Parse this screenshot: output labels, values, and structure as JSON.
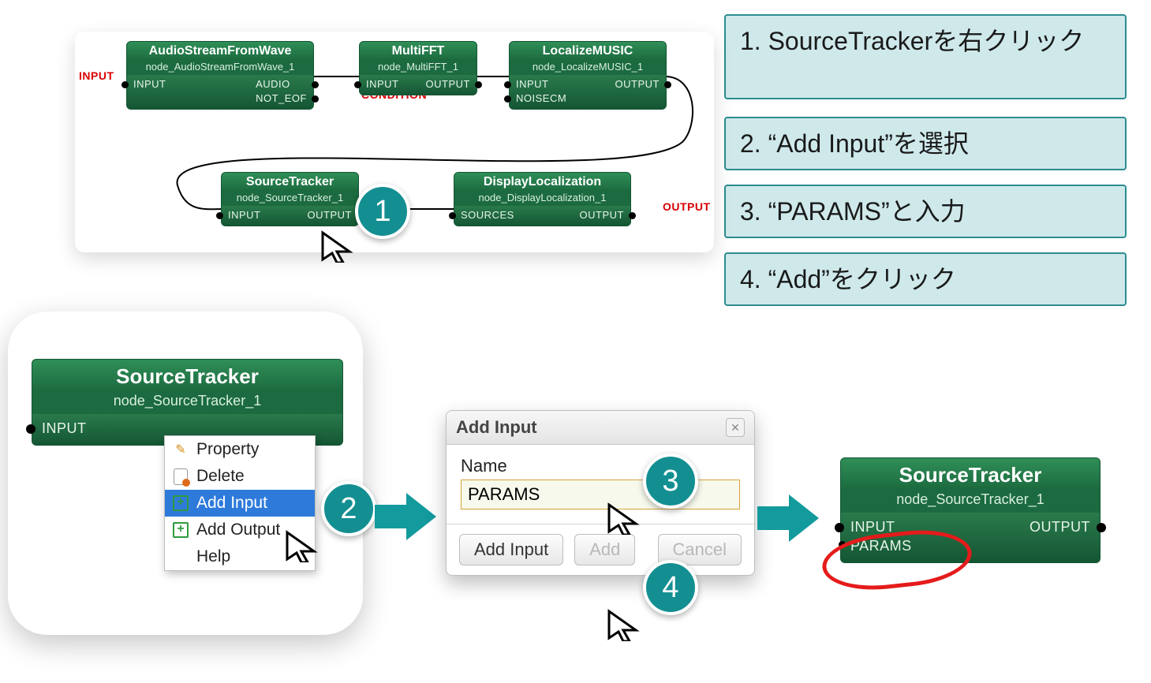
{
  "instructions": {
    "1": "1. SourceTrackerを右クリック",
    "2": "2. “Add Input”を選択",
    "3": "3. “PARAMS”と入力",
    "4": "4. “Add”をクリック"
  },
  "ext_labels": {
    "input": "INPUT",
    "output": "OUTPUT",
    "condition": "CONDITION"
  },
  "nodes": {
    "asfw": {
      "title": "AudioStreamFromWave",
      "id": "node_AudioStreamFromWave_1",
      "ins": [
        "INPUT"
      ],
      "outs": [
        "AUDIO",
        "NOT_EOF"
      ]
    },
    "mfft": {
      "title": "MultiFFT",
      "id": "node_MultiFFT_1",
      "ins": [
        "INPUT"
      ],
      "outs": [
        "OUTPUT"
      ]
    },
    "lmus": {
      "title": "LocalizeMUSIC",
      "id": "node_LocalizeMUSIC_1",
      "ins": [
        "INPUT",
        "NOISECM"
      ],
      "outs": [
        "OUTPUT"
      ]
    },
    "strk": {
      "title": "SourceTracker",
      "id": "node_SourceTracker_1",
      "ins": [
        "INPUT"
      ],
      "outs": [
        "OUTPUT"
      ]
    },
    "dloc": {
      "title": "DisplayLocalization",
      "id": "node_DisplayLocalization_1",
      "ins": [
        "SOURCES"
      ],
      "outs": [
        "OUTPUT"
      ]
    },
    "strk_big": {
      "title": "SourceTracker",
      "id": "node_SourceTracker_1",
      "in": "INPUT"
    },
    "strk_after": {
      "title": "SourceTracker",
      "id": "node_SourceTracker_1",
      "in1": "INPUT",
      "in2": "PARAMS",
      "out": "OUTPUT"
    }
  },
  "context_menu": {
    "items": [
      {
        "icon": "property",
        "label": "Property"
      },
      {
        "icon": "delete",
        "label": "Delete"
      },
      {
        "icon": "plus",
        "label": "Add Input",
        "hl": true
      },
      {
        "icon": "plus",
        "label": "Add Output"
      },
      {
        "icon": "",
        "label": "Help"
      }
    ]
  },
  "dialog": {
    "title": "Add Input",
    "field_label": "Name",
    "field_value": "PARAMS",
    "btn_secondary": "Add Input",
    "btn_add": "Add",
    "btn_cancel": "Cancel"
  },
  "badges": {
    "1": "1",
    "2": "2",
    "3": "3",
    "4": "4"
  }
}
